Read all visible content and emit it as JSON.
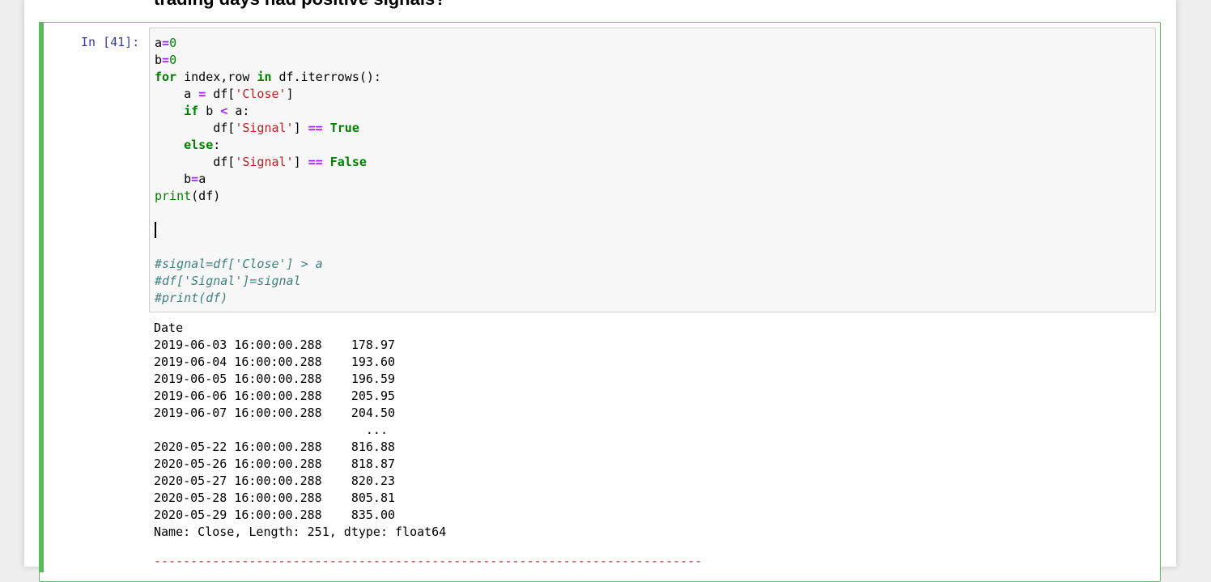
{
  "markdown": {
    "heading": "trading days had positive signals?"
  },
  "cell": {
    "prompt": "In [41]:",
    "code_lines": [
      [
        {
          "t": "a",
          "c": ""
        },
        {
          "t": "=",
          "c": "op"
        },
        {
          "t": "0",
          "c": "num"
        }
      ],
      [
        {
          "t": "b",
          "c": ""
        },
        {
          "t": "=",
          "c": "op"
        },
        {
          "t": "0",
          "c": "num"
        }
      ],
      [
        {
          "t": "for",
          "c": "kw"
        },
        {
          "t": " index,row ",
          "c": ""
        },
        {
          "t": "in",
          "c": "kw"
        },
        {
          "t": " df.iterrows():",
          "c": ""
        }
      ],
      [
        {
          "t": "    a ",
          "c": ""
        },
        {
          "t": "=",
          "c": "op"
        },
        {
          "t": " df[",
          "c": ""
        },
        {
          "t": "'Close'",
          "c": "str"
        },
        {
          "t": "]",
          "c": ""
        }
      ],
      [
        {
          "t": "    ",
          "c": ""
        },
        {
          "t": "if",
          "c": "kw"
        },
        {
          "t": " b ",
          "c": ""
        },
        {
          "t": "<",
          "c": "op"
        },
        {
          "t": " a:",
          "c": ""
        }
      ],
      [
        {
          "t": "        df[",
          "c": ""
        },
        {
          "t": "'Signal'",
          "c": "str"
        },
        {
          "t": "] ",
          "c": ""
        },
        {
          "t": "==",
          "c": "op"
        },
        {
          "t": " ",
          "c": ""
        },
        {
          "t": "True",
          "c": "kw"
        }
      ],
      [
        {
          "t": "    ",
          "c": ""
        },
        {
          "t": "else",
          "c": "kw"
        },
        {
          "t": ":",
          "c": ""
        }
      ],
      [
        {
          "t": "        df[",
          "c": ""
        },
        {
          "t": "'Signal'",
          "c": "str"
        },
        {
          "t": "] ",
          "c": ""
        },
        {
          "t": "==",
          "c": "op"
        },
        {
          "t": " ",
          "c": ""
        },
        {
          "t": "False",
          "c": "kw"
        }
      ],
      [
        {
          "t": "    b",
          "c": ""
        },
        {
          "t": "=",
          "c": "op"
        },
        {
          "t": "a",
          "c": ""
        }
      ],
      [
        {
          "t": "print",
          "c": "builtin"
        },
        {
          "t": "(df)",
          "c": ""
        }
      ],
      [],
      [
        {
          "t": "",
          "c": "cursor"
        }
      ],
      [],
      [
        {
          "t": "#signal=df['Close'] > a",
          "c": "cm"
        }
      ],
      [
        {
          "t": "#df['Signal']=signal",
          "c": "cm"
        }
      ],
      [
        {
          "t": "#print(df)",
          "c": "cm"
        }
      ]
    ],
    "output_lines": [
      "Date",
      "2019-06-03 16:00:00.288    178.97",
      "2019-06-04 16:00:00.288    193.60",
      "2019-06-05 16:00:00.288    196.59",
      "2019-06-06 16:00:00.288    205.95",
      "2019-06-07 16:00:00.288    204.50",
      "                             ...",
      "2020-05-22 16:00:00.288    816.88",
      "2020-05-26 16:00:00.288    818.87",
      "2020-05-27 16:00:00.288    820.23",
      "2020-05-28 16:00:00.288    805.81",
      "2020-05-29 16:00:00.288    835.00",
      "Name: Close, Length: 251, dtype: float64"
    ],
    "error_separator": "---------------------------------------------------------------------------"
  }
}
